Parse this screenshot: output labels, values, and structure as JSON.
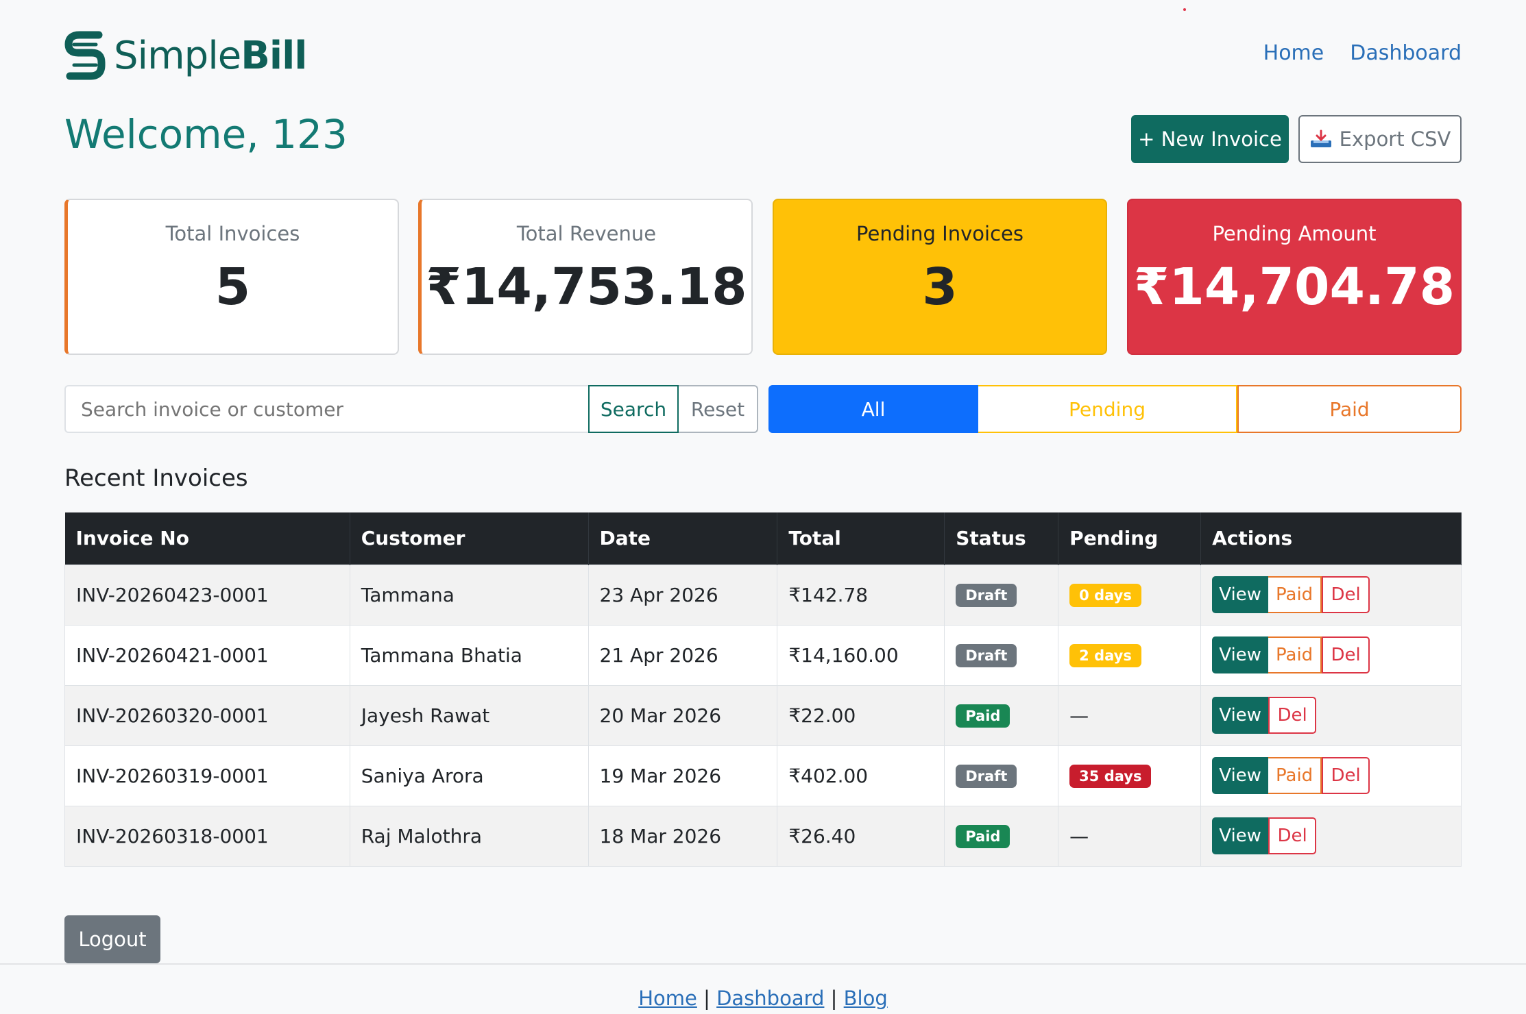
{
  "brand": {
    "name_light": "Simple",
    "name_bold": "Bill",
    "color": "#0f5f57"
  },
  "nav": {
    "home": "Home",
    "dashboard": "Dashboard"
  },
  "welcome": "Welcome, 123",
  "toolbar": {
    "new_invoice": "+ New Invoice",
    "export_csv": "Export CSV",
    "export_icon": "download-tray-icon"
  },
  "stats": {
    "total_invoices_label": "Total Invoices",
    "total_invoices_value": "5",
    "total_revenue_label": "Total Revenue",
    "total_revenue_value": "₹14,753.18",
    "pending_invoices_label": "Pending Invoices",
    "pending_invoices_value": "3",
    "pending_amount_label": "Pending Amount",
    "pending_amount_value": "₹14,704.78"
  },
  "search": {
    "placeholder": "Search invoice or customer",
    "search_label": "Search",
    "reset_label": "Reset"
  },
  "filters": {
    "all": "All",
    "pending": "Pending",
    "paid": "Paid",
    "active": "All"
  },
  "section_title": "Recent Invoices",
  "table": {
    "headers": [
      "Invoice No",
      "Customer",
      "Date",
      "Total",
      "Status",
      "Pending",
      "Actions"
    ],
    "rows": [
      {
        "invoice": "INV-20260423-0001",
        "customer": "Tammana",
        "date": "23 Apr 2026",
        "total": "₹142.78",
        "status": "Draft",
        "pending": "0 days",
        "actions": [
          "View",
          "Paid",
          "Del"
        ]
      },
      {
        "invoice": "INV-20260421-0001",
        "customer": "Tammana Bhatia",
        "date": "21 Apr 2026",
        "total": "₹14,160.00",
        "status": "Draft",
        "pending": "2 days",
        "actions": [
          "View",
          "Paid",
          "Del"
        ]
      },
      {
        "invoice": "INV-20260320-0001",
        "customer": "Jayesh Rawat",
        "date": "20 Mar 2026",
        "total": "₹22.00",
        "status": "Paid",
        "pending": "—",
        "actions": [
          "View",
          "Del"
        ]
      },
      {
        "invoice": "INV-20260319-0001",
        "customer": "Saniya Arora",
        "date": "19 Mar 2026",
        "total": "₹402.00",
        "status": "Draft",
        "pending": "35 days",
        "actions": [
          "View",
          "Paid",
          "Del"
        ]
      },
      {
        "invoice": "INV-20260318-0001",
        "customer": "Raj Malothra",
        "date": "18 Mar 2026",
        "total": "₹26.40",
        "status": "Paid",
        "pending": "—",
        "actions": [
          "View",
          "Del"
        ]
      }
    ]
  },
  "logout": "Logout",
  "footer": {
    "home": "Home",
    "dashboard": "Dashboard",
    "blog": "Blog",
    "separator": "|"
  },
  "colors": {
    "teal": "#0f6b60",
    "primary": "#0d6efd",
    "warning": "#ffc107",
    "danger": "#dc3545",
    "orange": "#e8772a",
    "success": "#198754",
    "secondary": "#6c757d"
  }
}
